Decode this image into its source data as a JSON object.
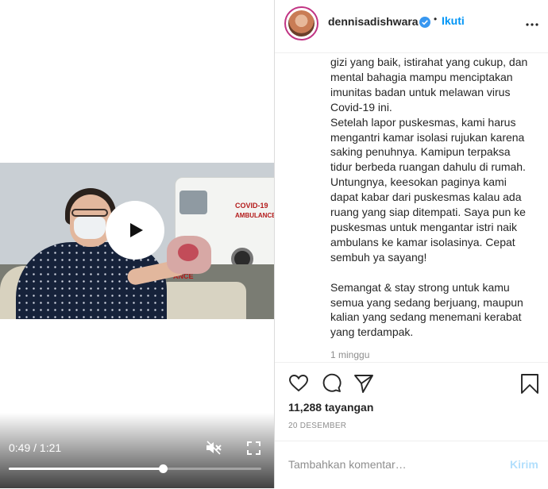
{
  "video": {
    "time_display": "0:49 / 1:21",
    "progress": 0.61,
    "scene_signs": {
      "line1": "COVID-19",
      "line2": "AMBULANCE",
      "line3": "ANCE"
    }
  },
  "post": {
    "username": "dennisadishwara",
    "follow_label": "Ikuti",
    "separator": "•",
    "caption": "gizi yang baik, istirahat yang cukup, dan\nmental bahagia mampu menciptakan\nimunitas badan untuk melawan virus\nCovid-19 ini.\nSetelah lapor puskesmas, kami harus\nmengantri kamar isolasi rujukan karena\nsaking penuhnya. Kamipun terpaksa\ntidur berbeda ruangan dahulu di rumah.\nUntungnya, keesokan paginya kami\ndapat kabar dari puskesmas kalau ada\nruang yang siap ditempati. Saya pun ke\npuskesmas untuk mengantar istri naik\nambulans ke kamar isolasinya. Cepat\nsembuh ya sayang!\n\nSemangat & stay strong untuk kamu\nsemua yang sedang berjuang, maupun\nkalian yang sedang menemani kerabat\nyang terdampak.",
    "caption_time": "1 minggu",
    "views": "11,288 tayangan",
    "date": "20 DESEMBER"
  },
  "comment": {
    "placeholder": "Tambahkan komentar…",
    "post_label": "Kirim"
  },
  "colors": {
    "accent": "#0095f6",
    "post_disabled": "#b2dffc",
    "text": "#262626",
    "muted": "#8e8e8e"
  },
  "icons": [
    "play-icon",
    "mute-icon",
    "fullscreen-icon",
    "verified-icon",
    "more-icon",
    "heart-icon",
    "comment-icon",
    "share-icon",
    "bookmark-icon"
  ]
}
